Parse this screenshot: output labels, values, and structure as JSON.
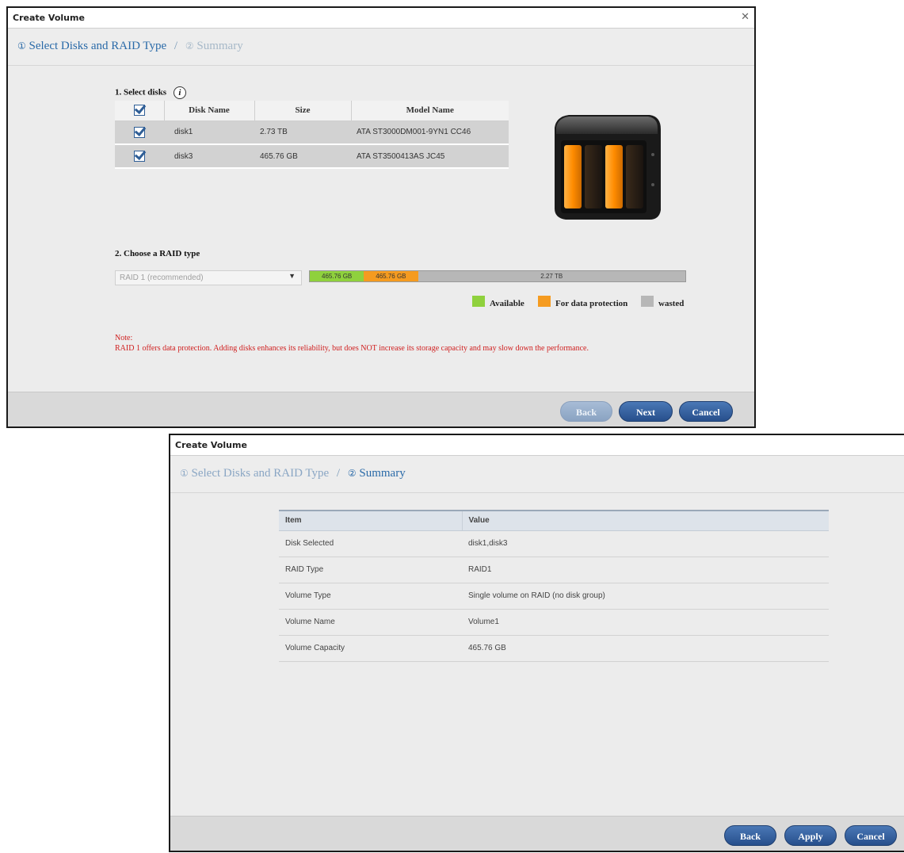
{
  "dialog1": {
    "title": "Create Volume",
    "close_icon": "close-icon",
    "steps": {
      "step1_num": "①",
      "step1_label": "Select Disks and RAID Type",
      "separator": "/",
      "step2_num": "②",
      "step2_label": "Summary"
    },
    "select_disks": {
      "label": "1. Select disks",
      "info_icon_glyph": "i",
      "columns": [
        "Disk Name",
        "Size",
        "Model Name"
      ],
      "rows": [
        {
          "name": "disk1",
          "size": "2.73 TB",
          "model": "ATA ST3000DM001-9YN1 CC46",
          "checked": true
        },
        {
          "name": "disk3",
          "size": "465.76 GB",
          "model": "ATA ST3500413AS JC45",
          "checked": true
        }
      ]
    },
    "raid": {
      "label": "2. Choose a RAID type",
      "selected": "RAID 1  (recommended)",
      "bar": [
        {
          "text": "465.76 GB",
          "color": "#8fd13d",
          "fraction": 0.144
        },
        {
          "text": "465.76 GB",
          "color": "#f59b20",
          "fraction": 0.144
        },
        {
          "text": "2.27 TB",
          "color": "#b7b7b7",
          "fraction": 0.712
        }
      ]
    },
    "legend": [
      {
        "label": "Available",
        "color": "#8fd13d"
      },
      {
        "label": "For data protection",
        "color": "#f59b20"
      },
      {
        "label": "wasted",
        "color": "#b7b7b7"
      }
    ],
    "note": {
      "title": "Note:",
      "text": "RAID 1 offers data protection. Adding disks enhances its reliability, but does NOT increase its storage capacity and may slow down the performance."
    },
    "buttons": {
      "back": "Back",
      "next": "Next",
      "cancel": "Cancel"
    }
  },
  "dialog2": {
    "title": "Create Volume",
    "steps": {
      "step1_num": "①",
      "step1_label": "Select Disks and RAID Type",
      "separator": "/",
      "step2_num": "②",
      "step2_label": "Summary"
    },
    "summary": {
      "columns": [
        "Item",
        "Value"
      ],
      "rows": [
        {
          "item": "Disk Selected",
          "value": "disk1,disk3"
        },
        {
          "item": "RAID Type",
          "value": "RAID1"
        },
        {
          "item": "Volume Type",
          "value": "Single volume on RAID (no disk group)"
        },
        {
          "item": "Volume Name",
          "value": "Volume1"
        },
        {
          "item": "Volume Capacity",
          "value": "465.76 GB"
        }
      ]
    },
    "buttons": {
      "back": "Back",
      "apply": "Apply",
      "cancel": "Cancel"
    }
  },
  "colors": {
    "accent": "#2a6aa8",
    "button": "#2f5a98",
    "note": "#d02020"
  }
}
